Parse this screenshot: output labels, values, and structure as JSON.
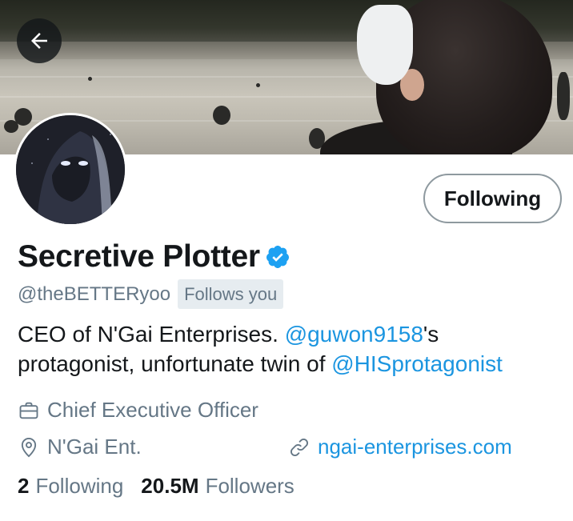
{
  "header": {
    "back_icon": "arrow-left-icon"
  },
  "profile": {
    "display_name": "Secretive Plotter",
    "verified": true,
    "verified_icon": "verified-badge-icon",
    "handle": "@theBETTERyoo",
    "follows_you": "Follows you",
    "follow_button_label": "Following",
    "bio": {
      "line1_text": "CEO of N'Gai Enterprises. ",
      "line1_mention": "@guwon9158",
      "line1_suffix": "'s",
      "line2_text": "protagonist, unfortunate twin of ",
      "line2_mention": "@HISprotagonist"
    },
    "occupation": "Chief Executive Officer",
    "occupation_icon": "briefcase-icon",
    "location": "N'Gai Ent.",
    "location_icon": "location-pin-icon",
    "website": "ngai-enterprises.com",
    "website_icon": "link-icon",
    "following_count": "2",
    "following_label": "Following",
    "followers_count": "20.5M",
    "followers_label": "Followers"
  },
  "colors": {
    "link_blue": "#1b95e0",
    "secondary_text": "#657786",
    "primary_text": "#14171a",
    "badge_bg": "#e6ecf0"
  }
}
